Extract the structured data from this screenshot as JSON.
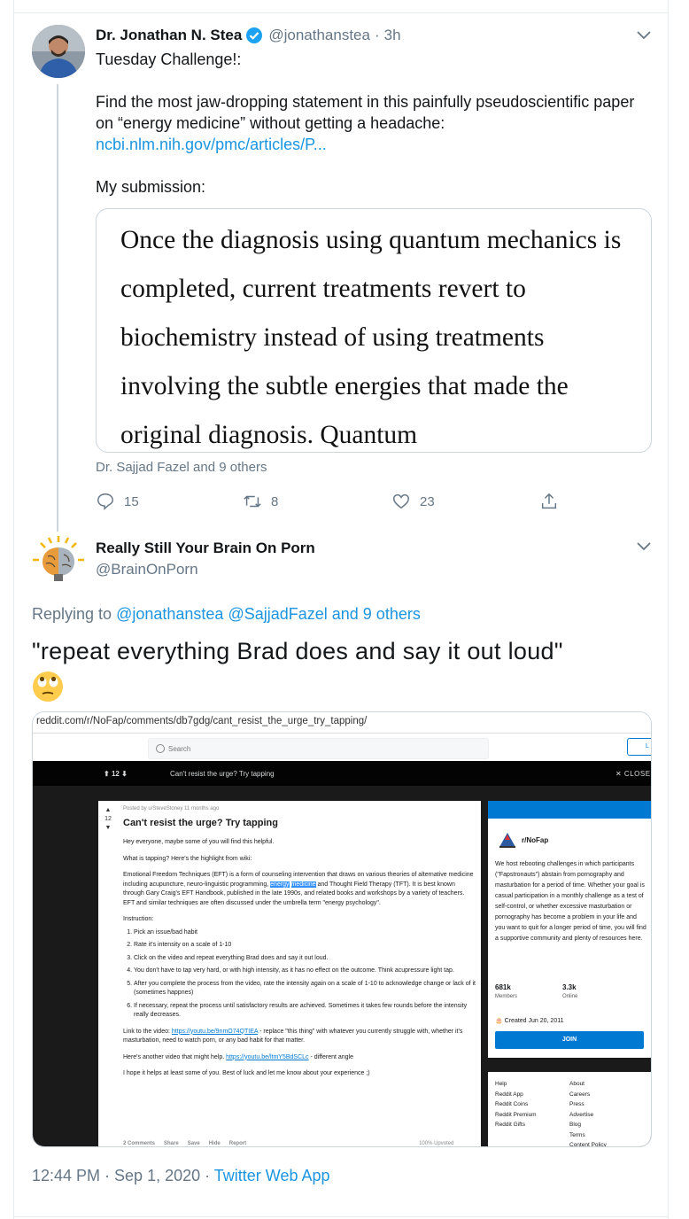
{
  "tweet1": {
    "name": "Dr. Jonathan N. Stea",
    "handle": "@jonathanstea",
    "dot": "·",
    "time": "3h",
    "line1": "Tuesday Challenge!:",
    "line2": "Find the most jaw-dropping statement in this painfully pseudoscientific paper on “energy medicine” without getting a headache:",
    "link": "ncbi.nlm.nih.gov/pmc/articles/P...",
    "line3": "My submission:",
    "card_text": "Once the diagnosis using quantum mechanics is completed, current treatments revert to biochemistry instead of using treatments involving the subtle energies that made the original diagnosis. Quantum",
    "tagged": "Dr. Sajjad Fazel and 9 others",
    "replies": "15",
    "retweets": "8",
    "likes": "23"
  },
  "tweet2": {
    "name": "Really Still Your Brain On Porn",
    "handle": "@BrainOnPorn",
    "replying_prefix": "Replying to",
    "replying_to": "@jonathanstea @SajjadFazel and 9 others",
    "text": "\"repeat everything Brad does and say it out loud\"",
    "timestamp": "12:44 PM · Sep 1, 2020 · ",
    "source": "Twitter Web App"
  },
  "reddit": {
    "url": "reddit.com/r/NoFap/comments/db7gdg/cant_resist_the_urge_try_tapping/",
    "search_placeholder": "Search",
    "login_fragment": "L",
    "vote_count": "12",
    "bar_title": "Can't resist the urge? Try tapping",
    "close": "✕ CLOSE",
    "meta": "Posted by u/SteveStoney 11 months ago",
    "title": "Can't resist the urge? Try tapping",
    "p1": "Hey everyone, maybe some of you will find this helpful.",
    "p2": "What is tapping? Here's the highlight from wiki:",
    "p3_a": "Emotional Freedom Techniques (EFT) is a form of counseling intervention that draws on various theories of alternative medicine including acupuncture, neuro-linguistic programming, ",
    "p3_hl1": "energy",
    "p3_hl2": "medicine",
    "p3_b": " and Thought Field Therapy (TFT). It is best known through Gary Craig's EFT Handbook, published in the late 1990s, and related books and workshops by a variety of teachers. EFT and similar techniques are often discussed under the umbrella term \"energy psychology\".",
    "instruction": "Instruction:",
    "steps": [
      "Pick an issue/bad habit",
      "Rate it's intensity on a scale of 1-10",
      "Click on the video and repeat everything Brad does and say it out loud.",
      "You don't have to tap very hard, or with high intensity, as it has no effect on the outcome. Think acupressure light tap.",
      "After you complete the process from the video, rate the intensity again on a scale of 1-10 to acknowledge change or lack of it (sometimes happnes)",
      "If necessary, repeat the process until satisfactory results are achieved. Sometimes it takes few rounds before the intensity really decreases."
    ],
    "link_a": "Link to the video: ",
    "link_url1": "https://youtu.be/9nmO74QTIEA",
    "link_b": " - replace \"this thing\" with whatever you currently struggle with, whether it's masturbation, need to watch porn, or any bad habit for that matter.",
    "another_a": "Here's another video that might help. ",
    "link_url2": "https://youtu.be/ltmY5BdSCLc",
    "another_b": " - different angle",
    "closing": "I hope it helps at least some of you. Best of luck and let me know about your experience ;)",
    "foot_comments": "2 Comments",
    "foot_share": "Share",
    "foot_save": "Save",
    "foot_hide": "Hide",
    "foot_report": "Report",
    "foot_upvoted": "100% Upvoted",
    "sub_name": "r/NoFap",
    "sub_desc": "We host rebooting challenges in which participants (\"Fapstronauts\") abstain from pornography and masturbation for a period of time. Whether your goal is casual participation in a monthly challenge as a test of self-control, or whether excessive masturbation or pornography has become a problem in your life and you want to quit for a longer period of time, you will find a supportive community and plenty of resources here.",
    "members": "681k",
    "members_label": "Members",
    "online": "3.3k",
    "online_label": "Online",
    "created": "Created Jun 20, 2011",
    "join": "JOIN",
    "footer_col1": [
      "Help",
      "Reddit App",
      "Reddit Coins",
      "Reddit Premium",
      "Reddit Gifts"
    ],
    "footer_col2": [
      "About",
      "Careers",
      "Press",
      "Advertise",
      "Blog",
      "Terms",
      "Content Policy"
    ]
  },
  "colors": {
    "twitter_blue": "#1b95e0",
    "muted": "#657786",
    "reddit_blue": "#0079d3",
    "verified": "#1da1f2"
  }
}
